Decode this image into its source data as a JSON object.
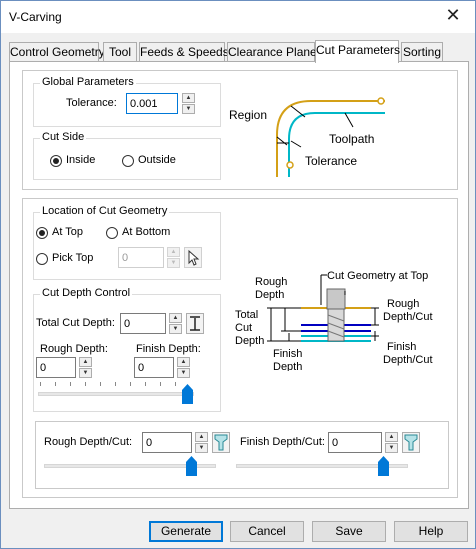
{
  "window": {
    "title": "V-Carving",
    "close_glyph": "✕"
  },
  "tabs": [
    {
      "label": "Control Geometry"
    },
    {
      "label": "Tool"
    },
    {
      "label": "Feeds & Speeds"
    },
    {
      "label": "Clearance Plane"
    },
    {
      "label": "Cut Parameters"
    },
    {
      "label": "Sorting"
    }
  ],
  "active_tab": "Cut Parameters",
  "global": {
    "title": "Global Parameters",
    "tolerance_label": "Tolerance:",
    "tolerance_value": "0.001"
  },
  "cut_side": {
    "title": "Cut Side",
    "inside_label": "Inside",
    "outside_label": "Outside",
    "selected": "Inside"
  },
  "diagram1": {
    "region": "Region",
    "toolpath": "Toolpath",
    "tolerance": "Tolerance"
  },
  "location": {
    "title": "Location of Cut Geometry",
    "at_top": "At Top",
    "at_bottom": "At Bottom",
    "pick_top": "Pick Top",
    "pick_value": "0",
    "selected": "At Top"
  },
  "depth": {
    "title": "Cut Depth Control",
    "total_label": "Total Cut Depth:",
    "total_value": "0",
    "rough_label": "Rough Depth:",
    "rough_value": "0",
    "finish_label": "Finish Depth:",
    "finish_value": "0",
    "depth_slider_value": 1.0
  },
  "diagram2": {
    "cut_geometry_at_top": "Cut Geometry at Top",
    "rough_depth_1": "Rough",
    "rough_depth_2": "Depth",
    "total_1": "Total",
    "total_2": "Cut",
    "total_3": "Depth",
    "finish_1": "Finish",
    "finish_2": "Depth",
    "rough_per_cut_1": "Rough",
    "rough_per_cut_2": "Depth/Cut",
    "finish_per_cut_1": "Finish",
    "finish_per_cut_2": "Depth/Cut"
  },
  "per_cut": {
    "rough_label": "Rough Depth/Cut:",
    "rough_value": "0",
    "finish_label": "Finish Depth/Cut:",
    "finish_value": "0",
    "rough_slider_value": 1.0,
    "finish_slider_value": 1.0
  },
  "buttons": {
    "generate": "Generate",
    "cancel": "Cancel",
    "save": "Save",
    "help": "Help"
  },
  "colors": {
    "accent": "#0078d7",
    "region": "#d4a017",
    "toolpath": "#00b7c7",
    "slider_thumb": "#0078d7"
  }
}
